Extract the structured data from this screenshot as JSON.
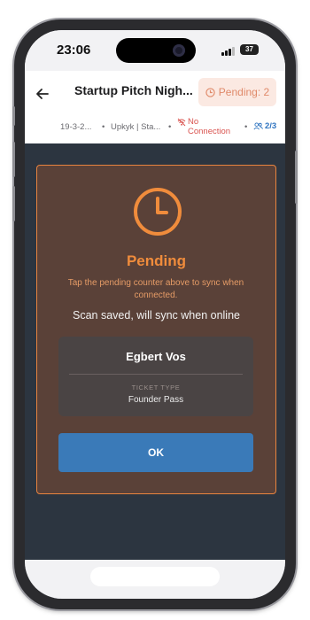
{
  "status_bar": {
    "time": "23:06",
    "battery": "37"
  },
  "header": {
    "title": "Startup Pitch Nigh...",
    "pending_badge": "Pending: 2",
    "date": "19-3-2...",
    "venue": "Upkyk | Sta...",
    "connection_line1": "No",
    "connection_line2": "Connection",
    "checkin_count": "2/3"
  },
  "modal": {
    "status_title": "Pending",
    "hint": "Tap the pending counter above to sync when connected.",
    "message": "Scan saved, will sync when online",
    "attendee_name": "Egbert Vos",
    "ticket_type_label": "TICKET TYPE",
    "ticket_type_value": "Founder Pass",
    "ok_label": "OK"
  },
  "colors": {
    "accent_orange": "#f08c3c",
    "error_red": "#d9534f",
    "primary_blue": "#3a7ab8",
    "badge_bg": "#fbe9e2"
  }
}
